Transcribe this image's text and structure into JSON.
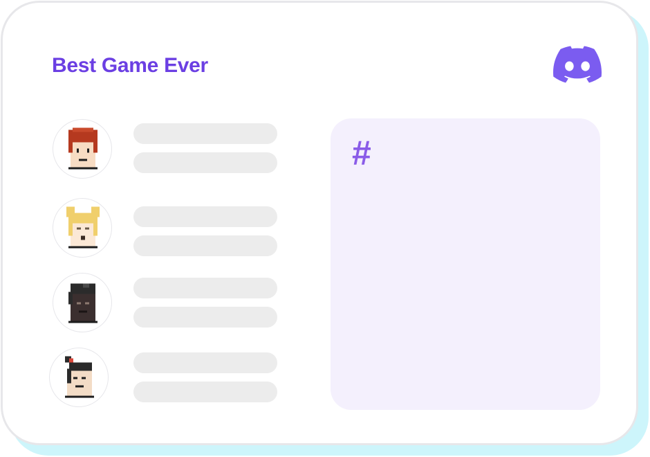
{
  "server": {
    "title": "Best Game Ever",
    "logo_icon": "discord-logo-icon",
    "accent_color": "#6b3fe3"
  },
  "members": [
    {
      "avatar_icon": "red-hair-pixel-avatar-icon",
      "hair_color": "#b5391f",
      "skin_color": "#f7dcc3"
    },
    {
      "avatar_icon": "blonde-hair-pixel-avatar-icon",
      "hair_color": "#f0cf6c",
      "skin_color": "#fbe8d6"
    },
    {
      "avatar_icon": "dark-skin-pixel-avatar-icon",
      "hair_color": "#2b2b2b",
      "skin_color": "#3b2f2f"
    },
    {
      "avatar_icon": "topknot-pixel-avatar-icon",
      "hair_color": "#2a2a2a",
      "skin_color": "#f3dcc6"
    }
  ],
  "channel": {
    "hash_symbol": "#",
    "panel_color": "#f4f0fd",
    "hash_color": "#8a5ce8"
  }
}
